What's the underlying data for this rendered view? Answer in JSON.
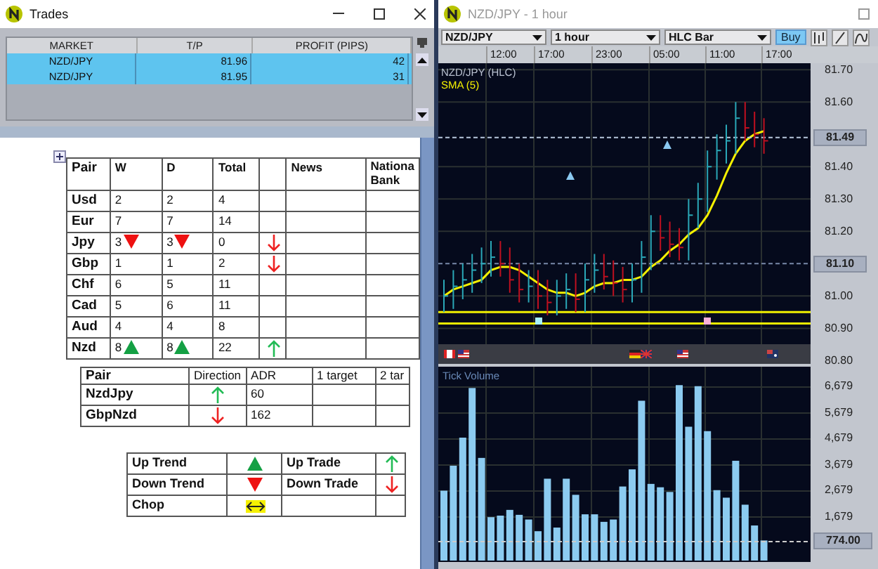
{
  "trades_window": {
    "title": "Trades",
    "columns": [
      "MARKET",
      "T/P",
      "PROFIT (PIPS)"
    ],
    "rows": [
      {
        "market": "NZD/JPY",
        "tp": "81.96",
        "profit": "42",
        "selected": true
      },
      {
        "market": "NZD/JPY",
        "tp": "81.95",
        "profit": "31",
        "selected": true
      }
    ]
  },
  "document": {
    "strength_table": {
      "columns": [
        "Pair",
        "W",
        "D",
        "Total",
        "News",
        "Nationa Bank"
      ],
      "rows": [
        {
          "pair": "Usd",
          "w": {
            "text": "2"
          },
          "d": {
            "text": "2"
          },
          "total": "4"
        },
        {
          "pair": "Eur",
          "w": {
            "text": "7"
          },
          "d": {
            "text": "7"
          },
          "total": "14"
        },
        {
          "pair": "Jpy",
          "w": {
            "text": "3",
            "kind": "trend_down"
          },
          "d": {
            "text": "3",
            "kind": "trend_down"
          },
          "total": "0",
          "trade": {
            "kind": "trade_down"
          }
        },
        {
          "pair": "Gbp",
          "w": {
            "text": "1"
          },
          "d": {
            "text": "1"
          },
          "total": "2",
          "trade": {
            "kind": "trade_down"
          }
        },
        {
          "pair": "Chf",
          "w": {
            "text": "6"
          },
          "d": {
            "text": "5"
          },
          "total": "11"
        },
        {
          "pair": "Cad",
          "w": {
            "text": "5"
          },
          "d": {
            "text": "6"
          },
          "total": "11"
        },
        {
          "pair": "Aud",
          "w": {
            "text": "4"
          },
          "d": {
            "text": "4"
          },
          "total": "8"
        },
        {
          "pair": "Nzd",
          "w": {
            "text": "8",
            "kind": "trend_up"
          },
          "d": {
            "text": "8",
            "kind": "trend_up"
          },
          "total": "22",
          "trade": {
            "kind": "trade_up"
          }
        }
      ]
    },
    "pair_table": {
      "columns": [
        "Pair",
        "Direction",
        "ADR",
        "1  target",
        "2  tar"
      ],
      "rows": [
        {
          "pair": "NzdJpy",
          "direction": {
            "kind": "trade_up"
          },
          "adr": "60"
        },
        {
          "pair": "GbpNzd",
          "direction": {
            "kind": "trade_down"
          },
          "adr": "162"
        }
      ]
    },
    "legend_table": {
      "rows": [
        {
          "left": {
            "label": "Up Trend",
            "kind": "trend_up"
          },
          "right": {
            "label": "Up Trade",
            "kind": "trade_up"
          }
        },
        {
          "left": {
            "label": "Down Trend",
            "kind": "trend_down"
          },
          "right": {
            "label": "Down Trade",
            "kind": "trade_down"
          }
        },
        {
          "left": {
            "label": "Chop",
            "kind": "chop"
          }
        }
      ]
    }
  },
  "chart_window": {
    "title": "NZD/JPY - 1 hour",
    "symbol": "NZD/JPY",
    "interval": "1 hour",
    "chart_type": "HLC Bar",
    "buy_button": "Buy",
    "time_labels": [
      "12:00",
      "17:00",
      "23:00",
      "05:00",
      "11:00",
      "17:00"
    ],
    "price_legend": "NZD/JPY (HLC)",
    "last_price": "81.49",
    "marker_price": "81.10",
    "price_chart": {
      "chart_data": {
        "type": "line",
        "grid": true,
        "ylim": [
          80.79,
          81.72
        ],
        "yticks": [
          {
            "value": 81.7,
            "label": "81.70"
          },
          {
            "value": 81.6,
            "label": "81.60"
          },
          {
            "value": 81.4,
            "label": "81.40"
          },
          {
            "value": 81.3,
            "label": "81.30"
          },
          {
            "value": 81.2,
            "label": "81.20"
          },
          {
            "value": 81.0,
            "label": "81.00"
          },
          {
            "value": 80.9,
            "label": "80.90"
          },
          {
            "value": 80.8,
            "label": "80.80"
          }
        ],
        "series": [
          {
            "name": "SMA (5)",
            "color": "#f4f000",
            "values": [
              81.0,
              81.02,
              81.03,
              81.04,
              81.05,
              81.08,
              81.09,
              81.09,
              81.08,
              81.06,
              81.04,
              81.02,
              81.01,
              81.01,
              81.0,
              81.01,
              81.03,
              81.04,
              81.04,
              81.05,
              81.05,
              81.06,
              81.09,
              81.11,
              81.14,
              81.16,
              81.19,
              81.21,
              81.25,
              81.31,
              81.38,
              81.44,
              81.48,
              81.5,
              81.51
            ]
          }
        ]
      }
    },
    "volume": {
      "last_value": "774.00",
      "chart_data": {
        "type": "bar",
        "title": "Tick Volume",
        "grid": true,
        "ylim": [
          0,
          7460
        ],
        "yticks": [
          {
            "value": 1679,
            "label": "1,679"
          },
          {
            "value": 2679,
            "label": "2,679"
          },
          {
            "value": 3679,
            "label": "3,679"
          },
          {
            "value": 4679,
            "label": "4,679"
          },
          {
            "value": 5679,
            "label": "5,679"
          },
          {
            "value": 6679,
            "label": "6,679"
          }
        ],
        "values": [
          2690,
          3650,
          4730,
          6640,
          3950,
          1670,
          1730,
          1950,
          1760,
          1580,
          1130,
          3150,
          1270,
          3150,
          2530,
          1780,
          1780,
          1490,
          1580,
          2850,
          3510,
          6150,
          2950,
          2820,
          2640,
          6750,
          5150,
          6710,
          4980,
          2710,
          2420,
          3840,
          2150,
          1350,
          774
        ]
      }
    }
  }
}
